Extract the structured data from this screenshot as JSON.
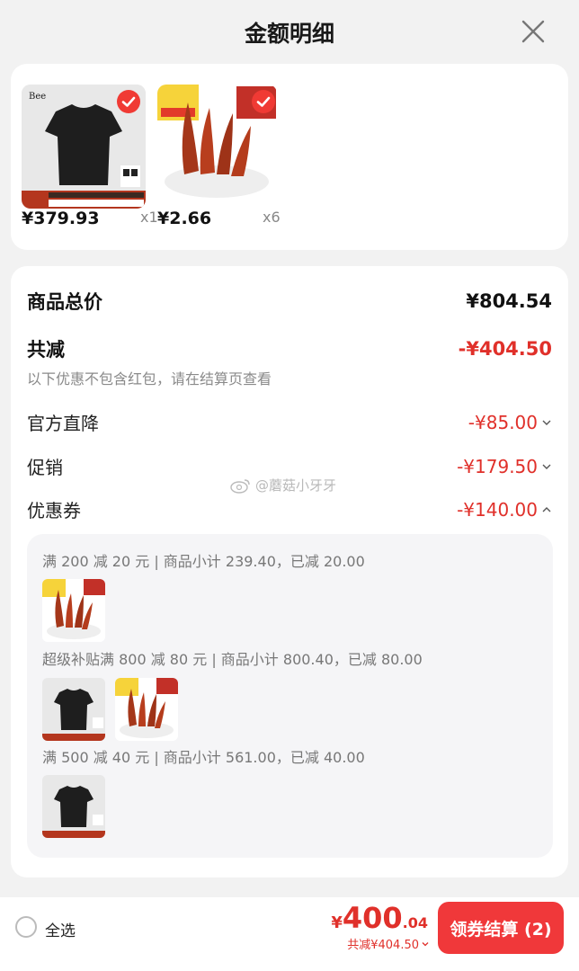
{
  "header": {
    "title": "金额明细"
  },
  "products": [
    {
      "price": "¥379.93",
      "qty": "x1",
      "logo_text": "Bee"
    },
    {
      "price": "¥2.66",
      "qty": "x6"
    }
  ],
  "summary": {
    "total_label": "商品总价",
    "total_value": "¥804.54",
    "discount_label": "共减",
    "discount_value": "-¥404.50",
    "note": "以下优惠不包含红包，请在结算页查看"
  },
  "discounts": [
    {
      "label": "官方直降",
      "value": "-¥85.00"
    },
    {
      "label": "促销",
      "value": "-¥179.50"
    },
    {
      "label": "优惠券",
      "value": "-¥140.00"
    }
  ],
  "coupons": [
    {
      "text": "满 200 减 20 元 | 商品小计 239.40，已减 20.00"
    },
    {
      "text": "超级补贴满 800 减 80 元 | 商品小计 800.40，已减 80.00"
    },
    {
      "text": "满 500 减 40 元 | 商品小计 561.00，已减 40.00"
    }
  ],
  "watermark": "@蘑菇小牙牙",
  "footer": {
    "select_all": "全选",
    "total_yen": "¥",
    "total_int": "400",
    "total_dec": ".04",
    "saved": "共减¥404.50",
    "checkout": "领券结算 (2)"
  },
  "colors": {
    "accent": "#e0302a",
    "button": "#f0383a"
  }
}
